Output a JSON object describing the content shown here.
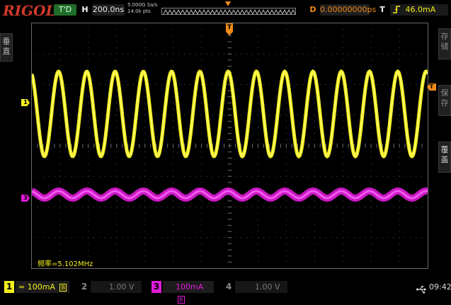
{
  "brand": "RIGOL",
  "status": {
    "run_state": "T'D",
    "h_label": "H",
    "timebase": "200.0ns",
    "sample_rate": "5.000G Sa/s",
    "memory_depth": "14.0k pts",
    "d_label": "D",
    "delay": "0.00000000ps",
    "t_label": "T",
    "trigger_level": "46.0mA"
  },
  "left_menu": {
    "vertical_label": "垂\n直"
  },
  "right_menu": {
    "store_label": "存\n储",
    "save_label": "保\n存",
    "overlay_label": "覆\n盖"
  },
  "markers": {
    "trigger_pos": "T",
    "ch1": "1",
    "ch3": "3",
    "trigger_level_marker": "T"
  },
  "measurement": "频率=5.102MHz",
  "channels": [
    {
      "num": "1",
      "scale": "= 100mA",
      "suffix": "B",
      "color": "#f2ee1a",
      "active": true
    },
    {
      "num": "2",
      "scale": "1.00 V",
      "suffix": "",
      "color": "#7a7a7a",
      "active": false
    },
    {
      "num": "3",
      "scale": "100mA",
      "suffix": "B",
      "color": "#e01ad8",
      "active": true
    },
    {
      "num": "4",
      "scale": "1.00 V",
      "suffix": "",
      "color": "#7a7a7a",
      "active": false
    }
  ],
  "clock": "09:42",
  "colors": {
    "ch1": "#f2ee1a",
    "ch3": "#e01ad8",
    "accent": "#f08a1a",
    "brand": "#d23a2a"
  },
  "waveform": {
    "ch1_cycles": 14,
    "ch3_cycles": 14
  }
}
